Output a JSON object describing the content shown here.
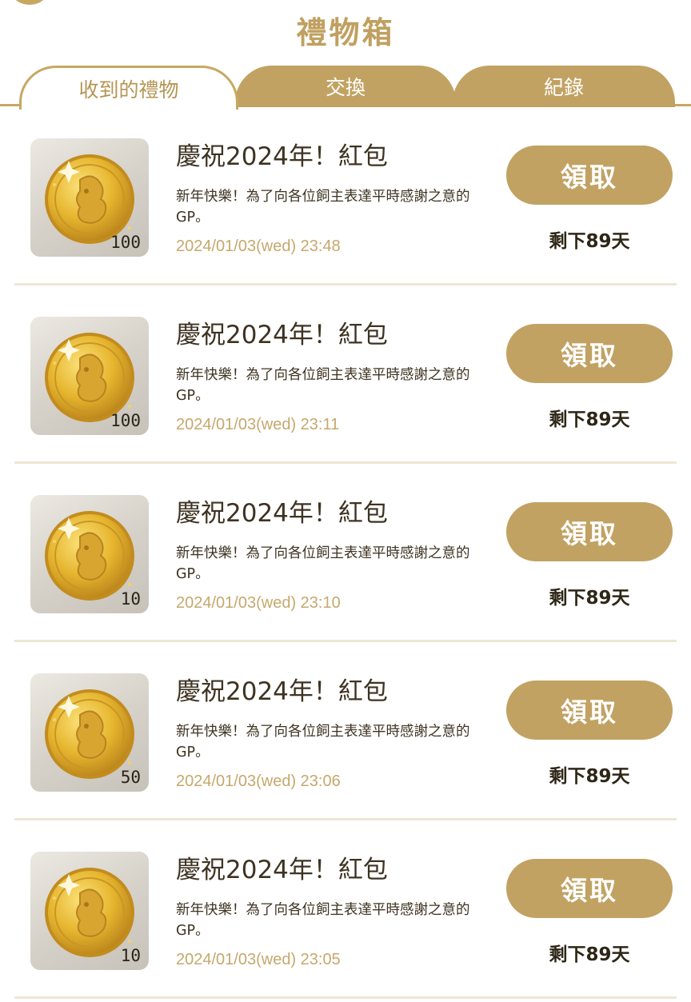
{
  "header": {
    "title": "禮物箱"
  },
  "tabs": [
    {
      "label": "收到的禮物",
      "active": true
    },
    {
      "label": "交換",
      "active": false
    },
    {
      "label": "紀錄",
      "active": false
    }
  ],
  "gifts": [
    {
      "title": "慶祝2024年！紅包",
      "description": "新年快樂！為了向各位飼主表達平時感謝之意的GP。",
      "quantity": "100",
      "date": "2024/01/03(wed) 23:48",
      "button": "領取",
      "remaining": "剩下89天",
      "icon": "gold-coin-icon"
    },
    {
      "title": "慶祝2024年！紅包",
      "description": "新年快樂！為了向各位飼主表達平時感謝之意的GP。",
      "quantity": "100",
      "date": "2024/01/03(wed) 23:11",
      "button": "領取",
      "remaining": "剩下89天",
      "icon": "gold-coin-icon"
    },
    {
      "title": "慶祝2024年！紅包",
      "description": "新年快樂！為了向各位飼主表達平時感謝之意的GP。",
      "quantity": "10",
      "date": "2024/01/03(wed) 23:10",
      "button": "領取",
      "remaining": "剩下89天",
      "icon": "gold-coin-icon"
    },
    {
      "title": "慶祝2024年！紅包",
      "description": "新年快樂！為了向各位飼主表達平時感謝之意的GP。",
      "quantity": "50",
      "date": "2024/01/03(wed) 23:06",
      "button": "領取",
      "remaining": "剩下89天",
      "icon": "gold-coin-icon"
    },
    {
      "title": "慶祝2024年！紅包",
      "description": "新年快樂！為了向各位飼主表達平時感謝之意的GP。",
      "quantity": "10",
      "date": "2024/01/03(wed) 23:05",
      "button": "領取",
      "remaining": "剩下89天",
      "icon": "gold-coin-icon"
    }
  ],
  "colors": {
    "accent": "#c1a263",
    "text": "#3e3322",
    "date": "#c6a86c",
    "divider": "#efe6d4"
  }
}
